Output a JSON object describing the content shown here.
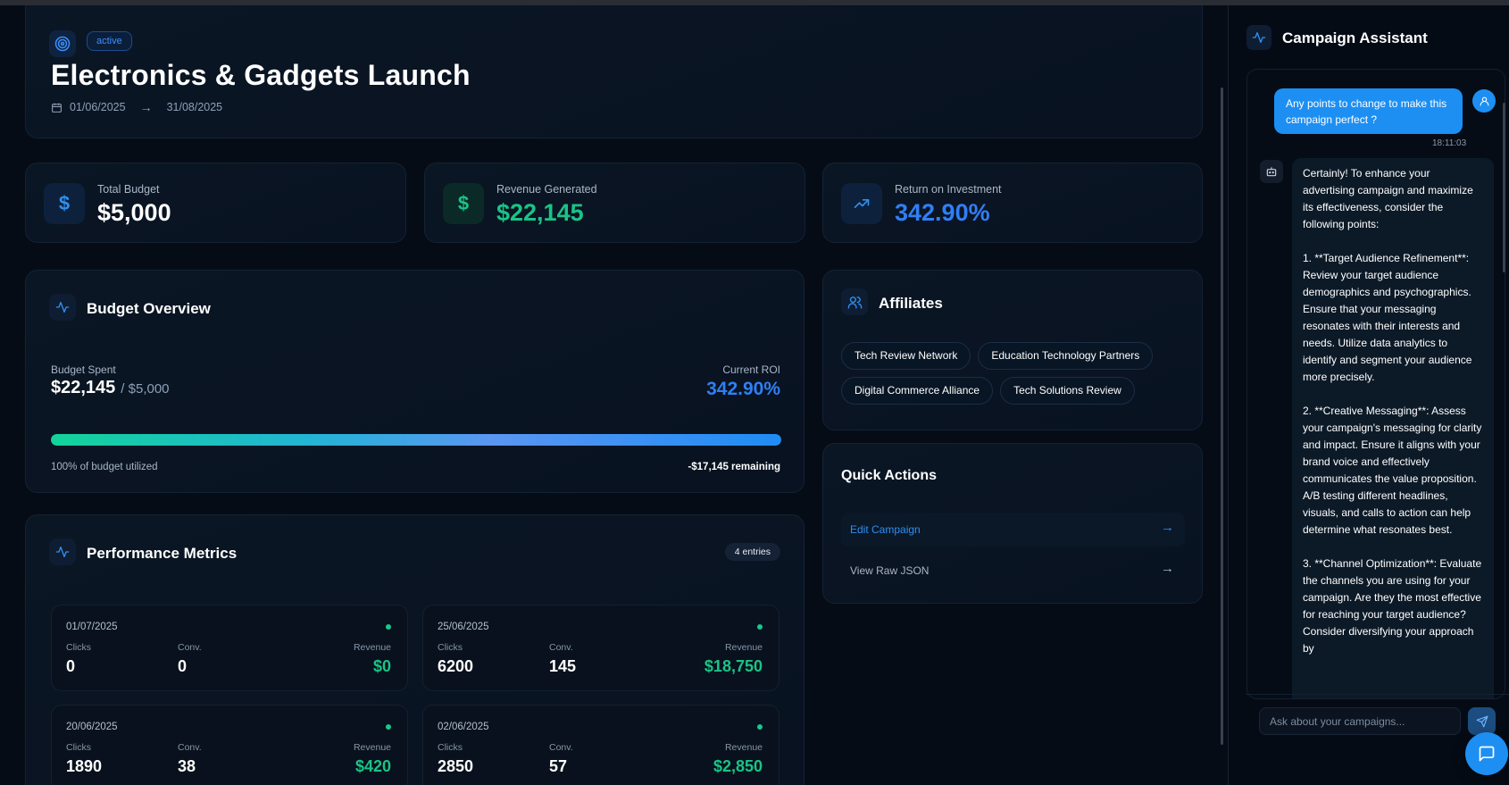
{
  "campaign": {
    "status": "active",
    "title": "Electronics & Gadgets Launch",
    "start_date": "01/06/2025",
    "end_date": "31/08/2025",
    "date_arrow": "→"
  },
  "stats": [
    {
      "label": "Total Budget",
      "value": "$5,000",
      "icon": "dollar-icon",
      "icon_glyph": "$",
      "color": "#ffffff",
      "icon_color": "#2f8ff0"
    },
    {
      "label": "Revenue Generated",
      "value": "$22,145",
      "icon": "dollar-icon",
      "icon_glyph": "$",
      "color": "#19c486",
      "icon_color": "#19c486"
    },
    {
      "label": "Return on Investment",
      "value": "342.90%",
      "icon": "trending-up-icon",
      "color": "#2f7ff5",
      "icon_color": "#2f8ff0"
    }
  ],
  "budget_overview": {
    "title": "Budget Overview",
    "spent_label": "Budget Spent",
    "spent_value": "$22,145",
    "total_value": "/ $5,000",
    "roi_label": "Current ROI",
    "roi_value": "342.90%",
    "utilized_text": "100% of budget utilized",
    "remaining_text": "-$17,145 remaining",
    "progress_fraction": 1.0
  },
  "performance": {
    "title": "Performance Metrics",
    "entries": "4 entries",
    "clicks_label": "Clicks",
    "conv_label": "Conv.",
    "revenue_label": "Revenue",
    "rows": [
      {
        "date": "01/07/2025",
        "clicks": "0",
        "conv": "0",
        "revenue": "$0"
      },
      {
        "date": "25/06/2025",
        "clicks": "6200",
        "conv": "145",
        "revenue": "$18,750"
      },
      {
        "date": "20/06/2025",
        "clicks": "1890",
        "conv": "38",
        "revenue": "$420"
      },
      {
        "date": "02/06/2025",
        "clicks": "2850",
        "conv": "57",
        "revenue": "$2,850"
      }
    ]
  },
  "affiliates": {
    "title": "Affiliates",
    "items": [
      "Tech Review Network",
      "Education Technology Partners",
      "Digital Commerce Alliance",
      "Tech Solutions Review"
    ]
  },
  "quick_actions": {
    "title": "Quick Actions",
    "items": [
      {
        "label": "Edit Campaign",
        "arrow": "→"
      },
      {
        "label": "View Raw JSON",
        "arrow": "→"
      }
    ]
  },
  "assistant": {
    "title": "Campaign Assistant",
    "user_message": "Any points to change to make this campaign perfect ?",
    "user_time": "18:11:03",
    "bot_message": "Certainly! To enhance your advertising campaign and maximize its effectiveness, consider the following points:\n\n1. **Target Audience Refinement**: Review your target audience demographics and psychographics. Ensure that your messaging resonates with their interests and needs. Utilize data analytics to identify and segment your audience more precisely.\n\n2. **Creative Messaging**: Assess your campaign's messaging for clarity and impact. Ensure it aligns with your brand voice and effectively communicates the value proposition. A/B testing different headlines, visuals, and calls to action can help determine what resonates best.\n\n3. **Channel Optimization**: Evaluate the channels you are using for your campaign. Are they the most effective for reaching your target audience? Consider diversifying your approach by",
    "input_placeholder": "Ask about your campaigns..."
  },
  "colors": {
    "accent_blue": "#1d8ff3",
    "success_green": "#19c486",
    "background": "#060c16"
  }
}
